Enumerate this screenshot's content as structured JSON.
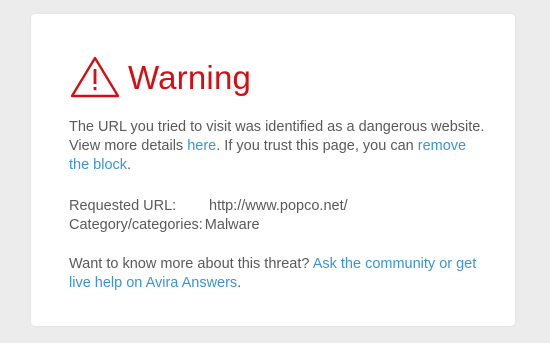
{
  "warning": {
    "icon": "warning-triangle-icon",
    "accent_color": "#d40f14",
    "title": "Warning"
  },
  "para1": {
    "text1": "The URL you tried to visit was identified as a dangerous website. View more details ",
    "link_here": "here",
    "text2": ". If you trust this page, you can ",
    "link_remove": "remove the block",
    "text3": "."
  },
  "details": {
    "url_label": "Requested URL:",
    "url_value": "http://www.popco.net/",
    "category_label": "Category/categories:",
    "category_value": "Malware"
  },
  "para3": {
    "text1": "Want to know more about this threat? ",
    "link_community": "Ask the community or get live help on Avira Answers",
    "text2": "."
  },
  "link_color": "#3c94d6"
}
